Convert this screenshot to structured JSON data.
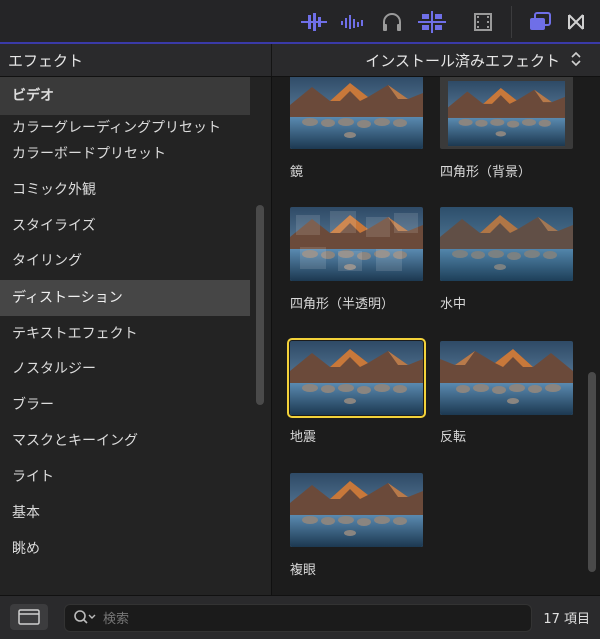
{
  "toolbar": {
    "icons": [
      "audio-waveform-icon",
      "audio-meters-icon",
      "headphones-icon",
      "snap-icon",
      "filmstrip-icon",
      "effects-browser-icon",
      "transitions-icon"
    ],
    "accent": "#6f6fe8"
  },
  "header": {
    "left_title": "エフェクト",
    "right_title": "インストール済みエフェクト"
  },
  "sidebar": {
    "items": [
      {
        "label": "ビデオ"
      },
      {
        "label": "カラーグレーディングプリセット"
      },
      {
        "label": "カラーボードプリセット"
      },
      {
        "label": "コミック外観"
      },
      {
        "label": "スタイライズ"
      },
      {
        "label": "タイリング"
      },
      {
        "label": "ディストーション"
      },
      {
        "label": "テキストエフェクト"
      },
      {
        "label": "ノスタルジー"
      },
      {
        "label": "ブラー"
      },
      {
        "label": "マスクとキーイング"
      },
      {
        "label": "ライト"
      },
      {
        "label": "基本"
      },
      {
        "label": "眺め"
      }
    ],
    "selected": "ディストーション"
  },
  "grid": {
    "items": [
      {
        "label": "鏡"
      },
      {
        "label": "四角形（背景）"
      },
      {
        "label": "四角形（半透明）"
      },
      {
        "label": "水中"
      },
      {
        "label": "地震"
      },
      {
        "label": "反転"
      },
      {
        "label": "複眼"
      }
    ],
    "selected": "地震",
    "selected_color": "#f3d23a"
  },
  "bottom": {
    "search_placeholder": "検索",
    "count": "17 項目"
  }
}
